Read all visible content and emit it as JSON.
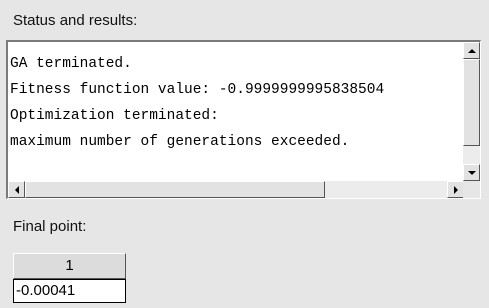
{
  "status_section": {
    "label": "Status and results:",
    "output_lines": [
      "GA terminated.",
      "Fitness function value: -0.9999999995838504",
      "Optimization terminated:",
      "maximum number of generations exceeded."
    ]
  },
  "final_point_section": {
    "label": "Final point:",
    "columns": [
      "1"
    ],
    "values": [
      "-0.00041"
    ]
  },
  "icons": {
    "scroll_up": "scroll-up-arrow-icon",
    "scroll_down": "scroll-down-arrow-icon",
    "scroll_left": "scroll-left-arrow-icon",
    "scroll_right": "scroll-right-arrow-icon"
  },
  "colors": {
    "panel_background": "#e6e6e6",
    "text_area_background": "#ffffff",
    "text": "#000000"
  }
}
